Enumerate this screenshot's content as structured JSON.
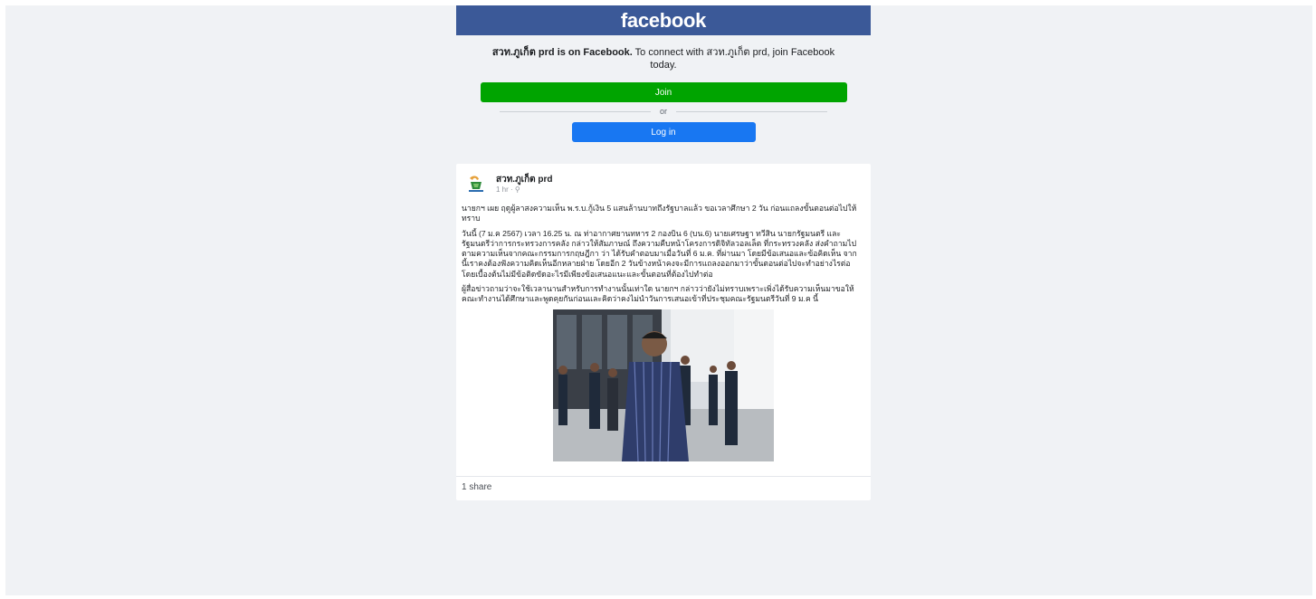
{
  "header": {
    "logo": "facebook"
  },
  "join_prompt": {
    "page_name": "สวท.ภูเก็ต prd",
    "is_on_facebook": " is on Facebook.",
    "connect_text": " To connect with สวท.ภูเก็ต prd, join Facebook today.",
    "join_label": "Join",
    "or_label": "or",
    "login_label": "Log in"
  },
  "post": {
    "author": "สวท.ภูเก็ต prd",
    "time": "1 hr · ⚲",
    "paragraphs": [
      "นายกฯ เผย ฤดูผู้ลาสงความเห็น พ.ร.บ.กู้เงิน 5 แสนล้านบาทถึงรัฐบาลแล้ว ขอเวลาศึกษา 2 วัน ก่อนแถลงขั้นตอนต่อไปให้ทราบ",
      "วันนี้ (7 ม.ค 2567) เวลา 16.25 น. ณ ท่าอากาศยานทหาร 2 กองบิน 6 (บน.6) นายเศรษฐา ทวีสิน นายกรัฐมนตรี และรัฐมนตรีว่าการกระทรวงการคลัง กล่าวให้สัมภาษณ์ ถึงความคืบหน้าโครงการดิจิทัลวอลเล็ต ที่กระทรวงคลัง ส่งคำถามไปตามความเห็นจากคณะกรรมการกฤษฎีกา ว่า ได้รับคำตอบมาเมื่อวันที่ 6 ม.ค. ที่ผ่านมา โดยมีข้อเสนอและข้อคิดเห็น จากนี้เราคงต้องฟังความคิดเห็นอีกหลายฝ่าย โดยอีก 2 วันข้างหน้าคงจะมีการแถลงออกมาว่าขั้นตอนต่อไปจะทำอย่างไรต่อ โดยเบื้องต้นไม่มีข้อติดขัดอะไรมีเพียงข้อเสนอแนะและขั้นตอนที่ต้องไปทำต่อ",
      "ผู้สื่อข่าวถามว่าจะใช้เวลานานสำหรับการทำงานนั้นเท่าใด นายกฯ กล่าวว่ายังไม่ทราบเพราะเพิ่งได้รับความเห็นมาขอให้คณะทำงานได้ศึกษาและพูดคุยกันก่อนและคิดว่าคงไม่นำวันการเสนอเข้าที่ประชุมคณะรัฐมนตรีวันที่ 9 ม.ค นี้"
    ],
    "share_count": "1 share"
  },
  "colors": {
    "header_blue": "#3b5998",
    "join_green": "#00a400",
    "login_blue": "#1877f2",
    "page_bg": "#f0f2f5"
  },
  "icons": {
    "avatar": "prd-logo-icon",
    "privacy": "globe-icon"
  }
}
